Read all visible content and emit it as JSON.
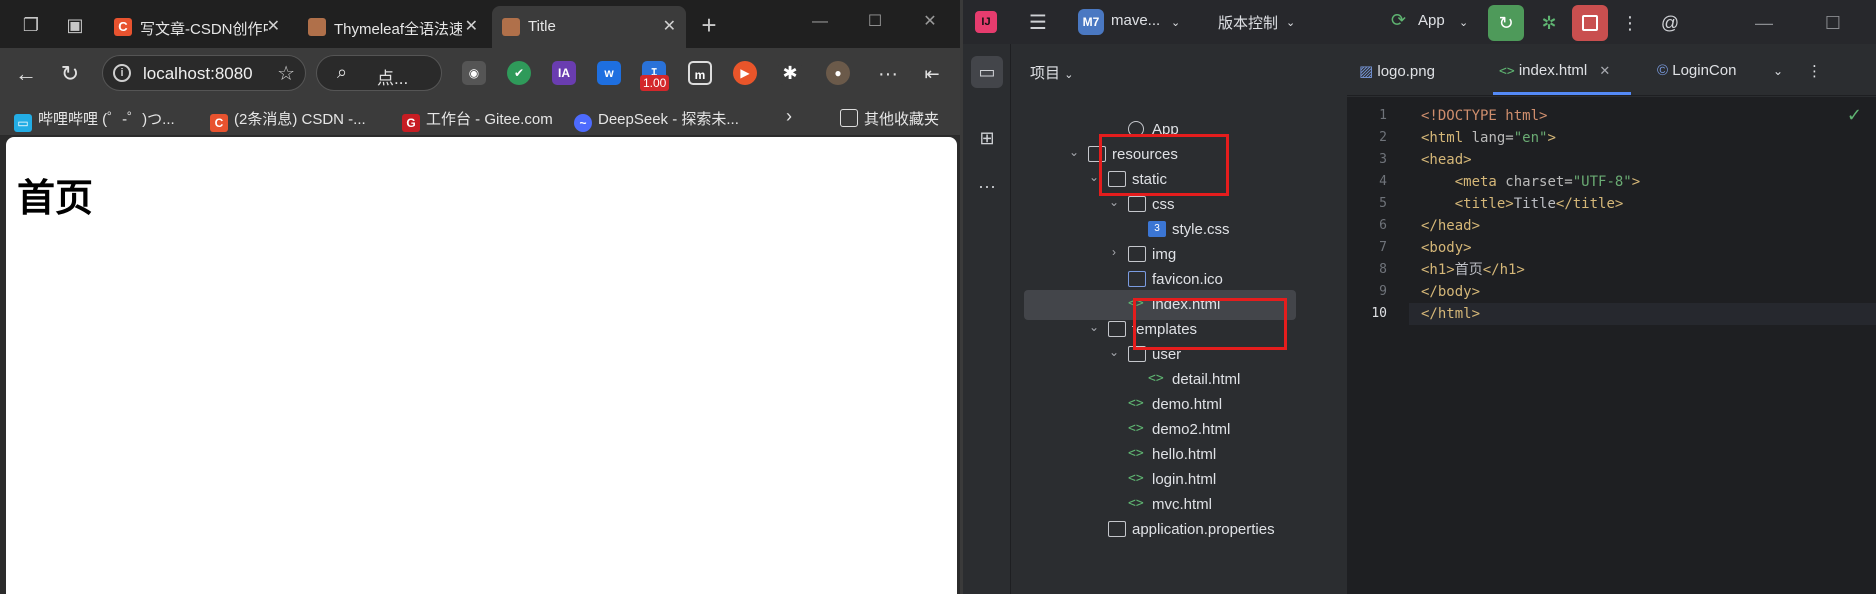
{
  "browser": {
    "tabs": [
      {
        "label": "写文章-CSDN创作中心",
        "color": "#e8532f",
        "glyph": "C"
      },
      {
        "label": "Thymeleaf全语法速查",
        "color": "#b0704a",
        "glyph": "T"
      },
      {
        "label": "Title",
        "color": "#b0704a",
        "glyph": "T"
      }
    ],
    "new_tab_glyph": "+",
    "address": "localhost:8080",
    "search_placeholder": "点...",
    "extension_badge": "1.00",
    "bookmarks": [
      {
        "label": "哔哩哔哩 (゜-゜)つ...",
        "color": "#23ade5"
      },
      {
        "label": "(2条消息) CSDN -...",
        "color": "#e8532f"
      },
      {
        "label": "工作台 - Gitee.com",
        "color": "#c71d23"
      },
      {
        "label": "DeepSeek - 探索未...",
        "color": "#4d6bfe"
      }
    ],
    "other_bookmarks": "其他收藏夹",
    "page_heading": "首页"
  },
  "ide": {
    "project_short": "M7",
    "project_name": "mave...",
    "vcs_label": "版本控制",
    "run_config": "App",
    "panel_title": "项目",
    "tree": [
      {
        "label": "App",
        "type": "app",
        "indent": 6,
        "chev": ""
      },
      {
        "label": "resources",
        "type": "folder",
        "indent": 4,
        "chev": "v"
      },
      {
        "label": "static",
        "type": "folder",
        "indent": 5,
        "chev": "v"
      },
      {
        "label": "css",
        "type": "folder",
        "indent": 6,
        "chev": "v"
      },
      {
        "label": "style.css",
        "type": "css",
        "indent": 7,
        "chev": ""
      },
      {
        "label": "img",
        "type": "folder",
        "indent": 6,
        "chev": ">"
      },
      {
        "label": "favicon.ico",
        "type": "image",
        "indent": 6,
        "chev": ""
      },
      {
        "label": "index.html",
        "type": "html",
        "indent": 6,
        "chev": "",
        "selected": true
      },
      {
        "label": "templates",
        "type": "folder",
        "indent": 5,
        "chev": "v"
      },
      {
        "label": "user",
        "type": "folder",
        "indent": 6,
        "chev": "v"
      },
      {
        "label": "detail.html",
        "type": "html",
        "indent": 7,
        "chev": ""
      },
      {
        "label": "demo.html",
        "type": "html",
        "indent": 6,
        "chev": ""
      },
      {
        "label": "demo2.html",
        "type": "html",
        "indent": 6,
        "chev": ""
      },
      {
        "label": "hello.html",
        "type": "html",
        "indent": 6,
        "chev": ""
      },
      {
        "label": "login.html",
        "type": "html",
        "indent": 6,
        "chev": ""
      },
      {
        "label": "mvc.html",
        "type": "html",
        "indent": 6,
        "chev": ""
      },
      {
        "label": "application.properties",
        "type": "props",
        "indent": 5,
        "chev": ""
      }
    ],
    "editor_tabs": [
      {
        "label": "logo.png",
        "icon": "image"
      },
      {
        "label": "index.html",
        "icon": "html",
        "active": true
      },
      {
        "label": "LoginCon",
        "icon": "class"
      }
    ],
    "code_lines": [
      [
        [
          "kw",
          "<!DOCTYPE html>"
        ]
      ],
      [
        [
          "tg",
          "<html"
        ],
        [
          "at",
          " lang="
        ],
        [
          "av",
          "\"en\""
        ],
        [
          "tg",
          ">"
        ]
      ],
      [
        [
          "tg",
          "<head>"
        ]
      ],
      [
        [
          "tx",
          "    "
        ],
        [
          "tg",
          "<meta"
        ],
        [
          "at",
          " charset="
        ],
        [
          "av",
          "\"UTF-8\""
        ],
        [
          "tg",
          ">"
        ]
      ],
      [
        [
          "tx",
          "    "
        ],
        [
          "tg",
          "<title>"
        ],
        [
          "tx",
          "Title"
        ],
        [
          "tg",
          "</title>"
        ]
      ],
      [
        [
          "tg",
          "</head>"
        ]
      ],
      [
        [
          "tg",
          "<body>"
        ]
      ],
      [
        [
          "tg",
          "<h1>"
        ],
        [
          "tx",
          "首页"
        ],
        [
          "tg",
          "</h1>"
        ]
      ],
      [
        [
          "tg",
          "</body>"
        ]
      ],
      [
        [
          "tg",
          "</html>"
        ]
      ]
    ],
    "current_line": 10
  }
}
